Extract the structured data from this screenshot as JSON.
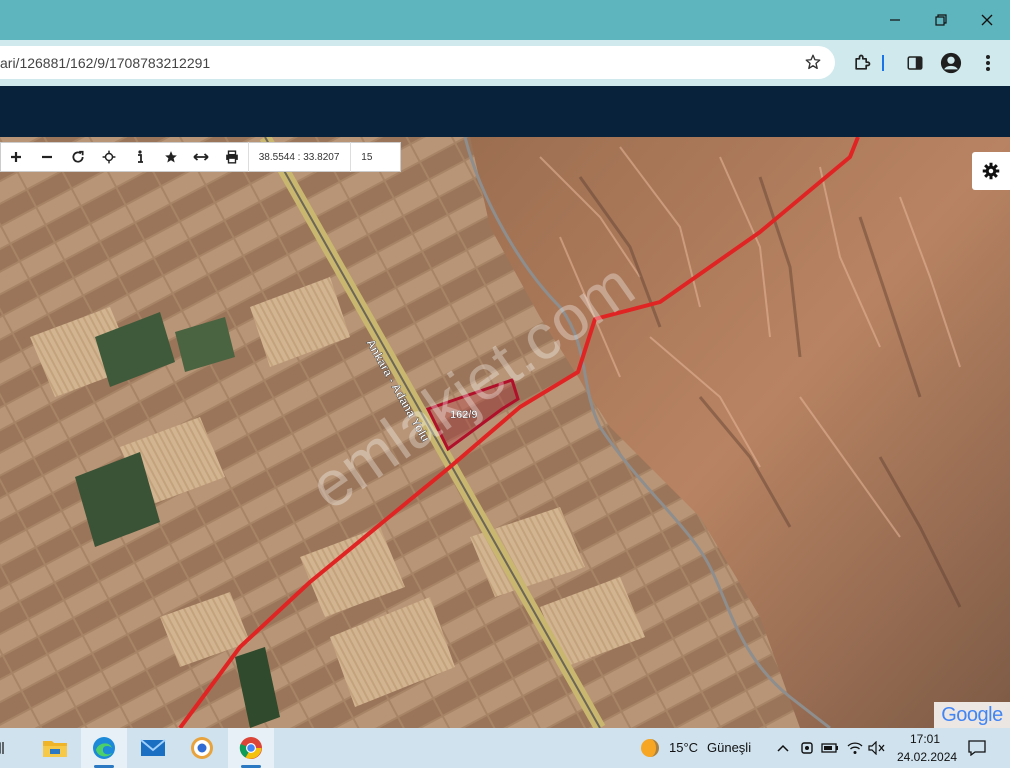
{
  "browser": {
    "url": "ari/126881/162/9/1708783212291"
  },
  "map": {
    "coordinates": "38.5544 : 33.8207",
    "zoom": "15",
    "parcel_label": "162/9",
    "road_label": "Ankara - Adana Yolu",
    "watermark": "emlakjet.com",
    "attribution": "Google",
    "toolbar_buttons": [
      "zoom-in",
      "zoom-out",
      "refresh",
      "locate",
      "info",
      "favorite",
      "measure",
      "print"
    ]
  },
  "taskbar": {
    "weather_temp": "15°C",
    "weather_desc": "Güneşli",
    "time": "17:01",
    "date": "24.02.2024"
  },
  "colors": {
    "title_bar": "#5fb5be",
    "browser_toolbar": "#cfe9ec",
    "site_header": "#07223a",
    "route": "#e02424",
    "parcel": "#b0102a",
    "taskbar": "#cfe2ee"
  }
}
